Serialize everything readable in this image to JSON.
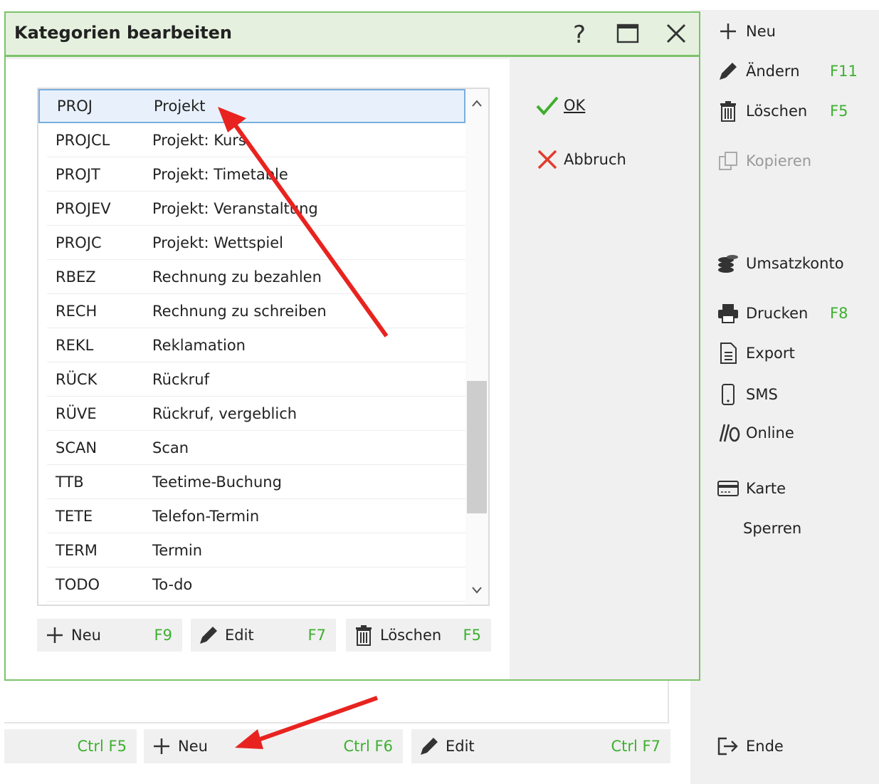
{
  "dialog": {
    "title": "Kategorien bearbeiten",
    "help_symbol": "?",
    "ok_label": "OK",
    "cancel_label": "Abbruch",
    "rows": [
      {
        "code": "PROJ",
        "name": "Projekt"
      },
      {
        "code": "PROJCL",
        "name": "Projekt: Kurs"
      },
      {
        "code": "PROJT",
        "name": "Projekt: Timetable"
      },
      {
        "code": "PROJEV",
        "name": "Projekt: Veranstaltung"
      },
      {
        "code": "PROJC",
        "name": "Projekt: Wettspiel"
      },
      {
        "code": "RBEZ",
        "name": "Rechnung zu bezahlen"
      },
      {
        "code": "RECH",
        "name": "Rechnung zu schreiben"
      },
      {
        "code": "REKL",
        "name": "Reklamation"
      },
      {
        "code": "RÜCK",
        "name": "Rückruf"
      },
      {
        "code": "RÜVE",
        "name": "Rückruf, vergeblich"
      },
      {
        "code": "SCAN",
        "name": "Scan"
      },
      {
        "code": "TTB",
        "name": "Teetime-Buchung"
      },
      {
        "code": "TETE",
        "name": "Telefon-Termin"
      },
      {
        "code": "TERM",
        "name": "Termin"
      },
      {
        "code": "TODO",
        "name": "To-do"
      }
    ],
    "list_buttons": {
      "new_label": "Neu",
      "new_key": "F9",
      "edit_label": "Edit",
      "edit_key": "F7",
      "delete_label": "Löschen",
      "delete_key": "F5"
    }
  },
  "sidebar": {
    "new_label": "Neu",
    "change_label": "Ändern",
    "change_key": "F11",
    "delete_label": "Löschen",
    "delete_key": "F5",
    "copy_label": "Kopieren",
    "account_label": "Umsatzkonto",
    "print_label": "Drucken",
    "print_key": "F8",
    "export_label": "Export",
    "sms_label": "SMS",
    "online_label": "Online",
    "card_label": "Karte",
    "lock_label": "Sperren",
    "end_label": "Ende"
  },
  "bottom_bar": {
    "key1": "Ctrl F5",
    "new_label": "Neu",
    "key2": "Ctrl F6",
    "edit_label": "Edit",
    "key3": "Ctrl F7"
  },
  "colors": {
    "accent_green": "#7cc36a",
    "shortcut_green": "#3db02f",
    "annotation_red": "#e8231f"
  }
}
